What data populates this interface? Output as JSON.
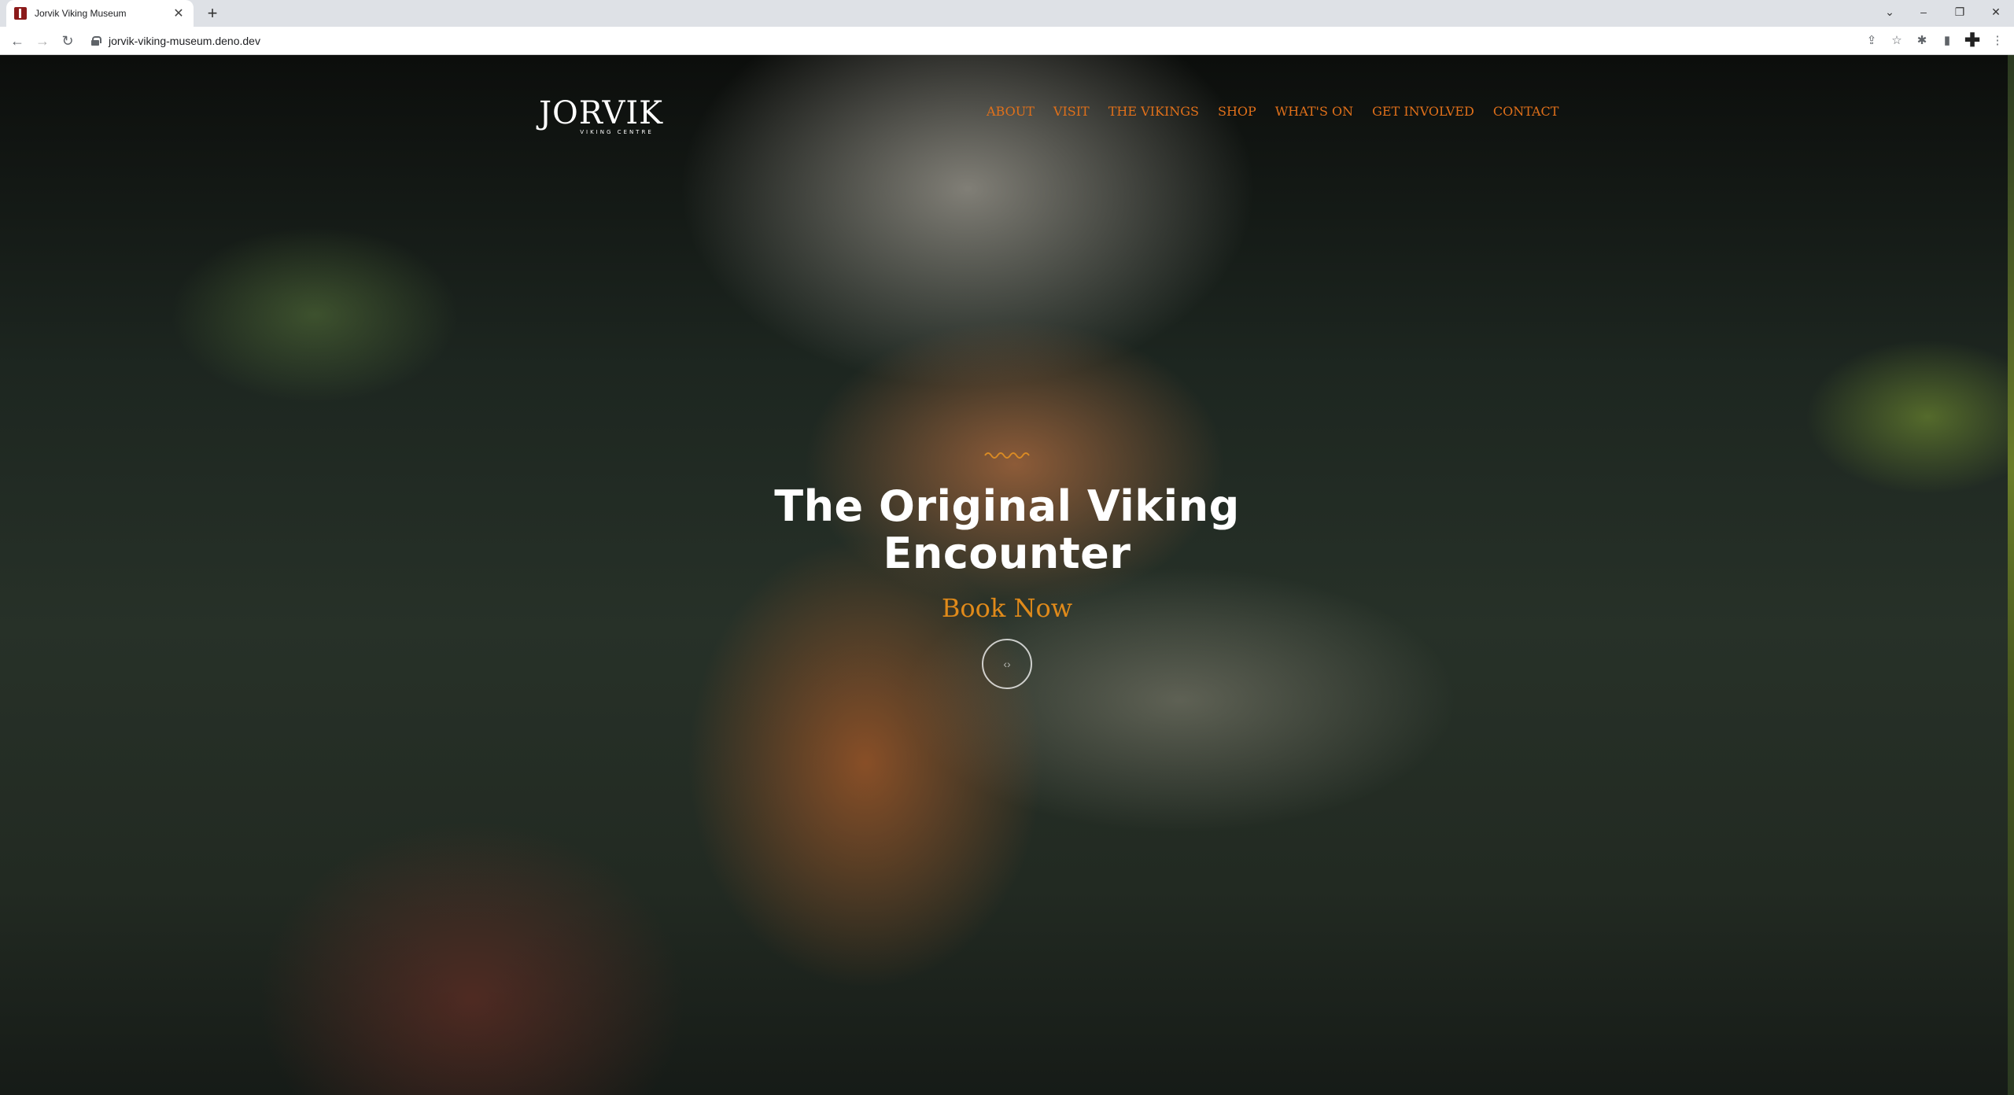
{
  "browser": {
    "tab_title": "Jorvik Viking Museum",
    "tab_close": "✕",
    "new_tab": "+",
    "url": "jorvik-viking-museum.deno.dev",
    "window_controls": {
      "tab_list": "⌄",
      "minimize": "–",
      "restore": "❐",
      "close": "✕"
    },
    "nav": {
      "back": "←",
      "forward": "→",
      "reload": "↻"
    },
    "toolbar_icons": {
      "share": "⇪",
      "bookmark": "☆",
      "extensions": "✱",
      "side_panel": "▮",
      "ext_plus": "✚",
      "menu": "⋮"
    }
  },
  "site": {
    "logo_word": "JORVIK",
    "logo_sub": "VIKING CENTRE",
    "nav_items": [
      "ABOUT",
      "VISIT",
      "THE VIKINGS",
      "SHOP",
      "WHAT'S ON",
      "GET INVOLVED",
      "CONTACT"
    ],
    "hero_title_line1": "The Original Viking",
    "hero_title_line2": "Encounter",
    "book_now": "Book Now",
    "play_glyph": "‹›"
  },
  "colors": {
    "accent": "#e0701a",
    "book_now": "#e08a1a",
    "hero_text": "#ffffff"
  }
}
